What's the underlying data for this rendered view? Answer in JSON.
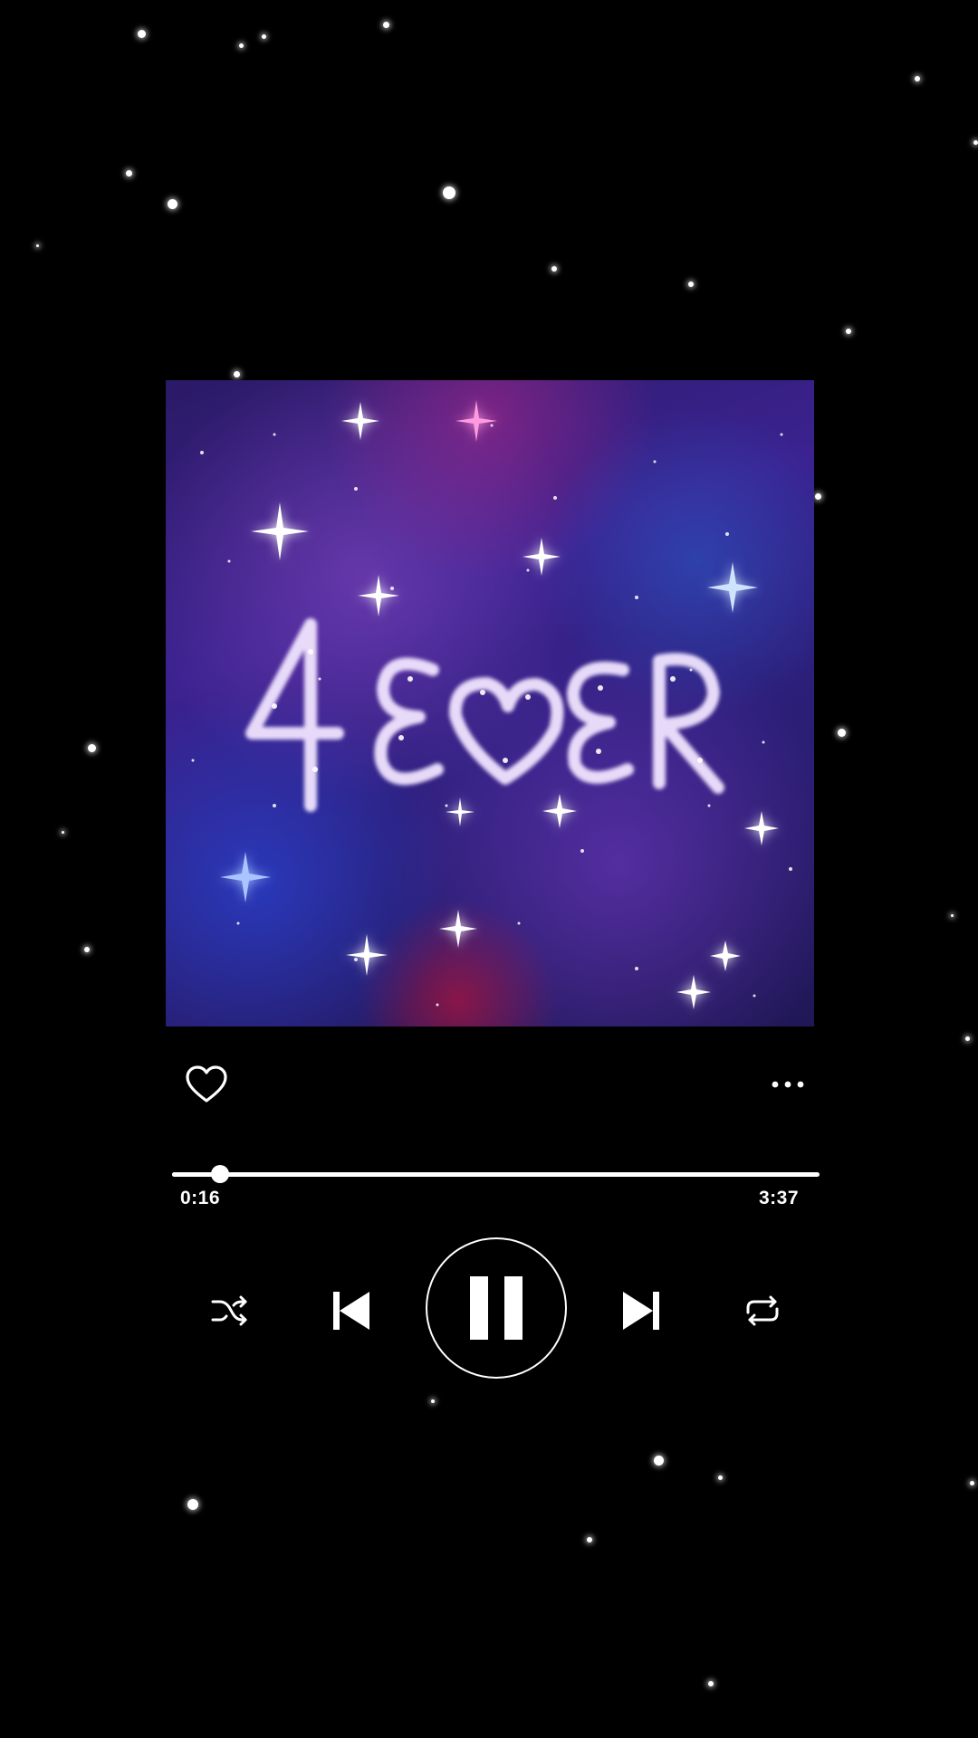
{
  "player": {
    "album_art_text": "4EVER",
    "liked": false,
    "progress": {
      "elapsed": "0:16",
      "total": "3:37",
      "fraction": 0.074
    },
    "state": "playing"
  },
  "icons": {
    "like": "heart-outline-icon",
    "more": "more-options-icon",
    "shuffle": "shuffle-icon",
    "previous": "skip-previous-icon",
    "play_pause": "pause-icon",
    "next": "skip-next-icon",
    "repeat": "repeat-icon"
  },
  "colors": {
    "background": "#000000",
    "foreground": "#ffffff",
    "art_base": "#3b2290"
  }
}
